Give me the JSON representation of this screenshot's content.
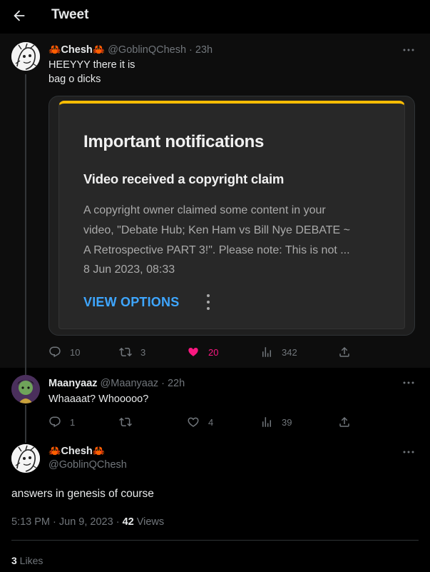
{
  "header": {
    "title": "Tweet",
    "back_icon": "arrow-left-icon"
  },
  "tweet1": {
    "author": {
      "prefix": "🦀",
      "name": "Chesh",
      "suffix": "🦀",
      "handle": "@GoblinQChesh",
      "time": "23h"
    },
    "text_line1": "HEEYYY there it is",
    "text_line2": "bag o dicks",
    "embedded": {
      "title": "Important notifications",
      "subtitle": "Video received a copyright claim",
      "body": [
        "A copyright owner claimed some content in your",
        "video, \"Debate Hub; Ken Ham vs Bill Nye DEBATE ~",
        "A Retrospective PART 3!\". Please note: This is not ..."
      ],
      "date": "8 Jun 2023, 08:33",
      "button": "VIEW OPTIONS",
      "accent": "#fbbc04",
      "button_color": "#3ea6ff"
    },
    "stats": {
      "replies": "10",
      "retweets": "3",
      "likes": "20",
      "views": "342"
    },
    "liked": true
  },
  "tweet2": {
    "author": {
      "name": "Maanyaaz",
      "handle": "@Maanyaaz",
      "time": "22h"
    },
    "text": "Whaaaat? Whooooo?",
    "stats": {
      "replies": "1",
      "retweets": "",
      "likes": "4",
      "views": "39"
    }
  },
  "main_tweet": {
    "author": {
      "prefix": "🦀",
      "name": "Chesh",
      "suffix": "🦀",
      "handle": "@GoblinQChesh"
    },
    "text": "answers in genesis of course",
    "time": "5:13 PM · Jun 9, 2023 · ",
    "views_count": "42",
    "views_label": " Views",
    "likes_count": "3",
    "likes_label": " Likes"
  },
  "colors": {
    "like": "#f91880",
    "muted": "#71767b",
    "text": "#e7e9ea"
  }
}
